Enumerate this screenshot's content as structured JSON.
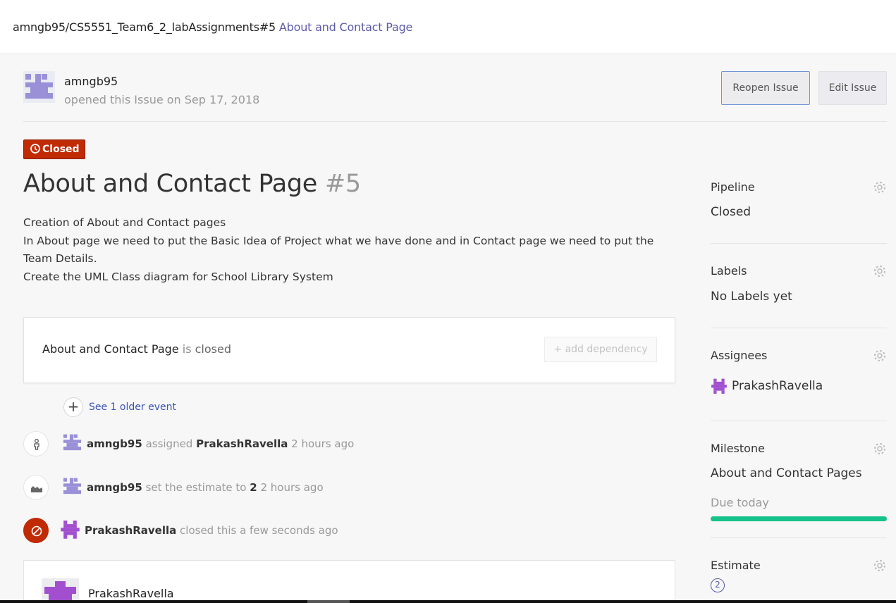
{
  "breadcrumb": {
    "repo_issue": "amngb95/CS5551_Team6_2_labAssignments#5",
    "issue_title": "About and Contact Page"
  },
  "header": {
    "author": "amngb95",
    "opened_text": "opened this Issue on Sep 17, 2018",
    "reopen_label": "Reopen Issue",
    "edit_label": "Edit Issue"
  },
  "issue": {
    "status": "Closed",
    "title": "About and Contact Page",
    "number": "#5",
    "description": [
      "Creation of About and Contact pages",
      "In About page we need to put the Basic Idea of Project what we have done and in Contact page we need to put the Team Details.",
      "Create the UML Class diagram for School Library System"
    ]
  },
  "dependency": {
    "title": "About and Contact Page",
    "connector": "is",
    "state": "closed",
    "add_label": "+ add dependency"
  },
  "timeline": {
    "older_link": "See 1 older event",
    "events": [
      {
        "icon": "person-icon",
        "actor": "amngb95",
        "action": "assigned",
        "target": "PrakashRavella",
        "time": "2 hours ago"
      },
      {
        "icon": "estimate-icon",
        "actor": "amngb95",
        "action": "set the estimate to",
        "target": "2",
        "time": "2 hours ago"
      },
      {
        "icon": "closed-icon",
        "actor": "PrakashRavella",
        "action": "closed this a few seconds ago"
      }
    ]
  },
  "comment": {
    "author": "PrakashRavella"
  },
  "sidebar": {
    "pipeline": {
      "heading": "Pipeline",
      "value": "Closed"
    },
    "labels": {
      "heading": "Labels",
      "value": "No Labels yet"
    },
    "assignees": {
      "heading": "Assignees",
      "value": "PrakashRavella"
    },
    "milestone": {
      "heading": "Milestone",
      "value": "About and Contact Pages",
      "due": "Due today",
      "progress": 1.0
    },
    "estimate": {
      "heading": "Estimate",
      "value": "2"
    }
  },
  "colors": {
    "accent": "#5a5aa8",
    "closed_red": "#c02a05",
    "progress_green": "#14c28a",
    "link_blue": "#3b54b8"
  }
}
